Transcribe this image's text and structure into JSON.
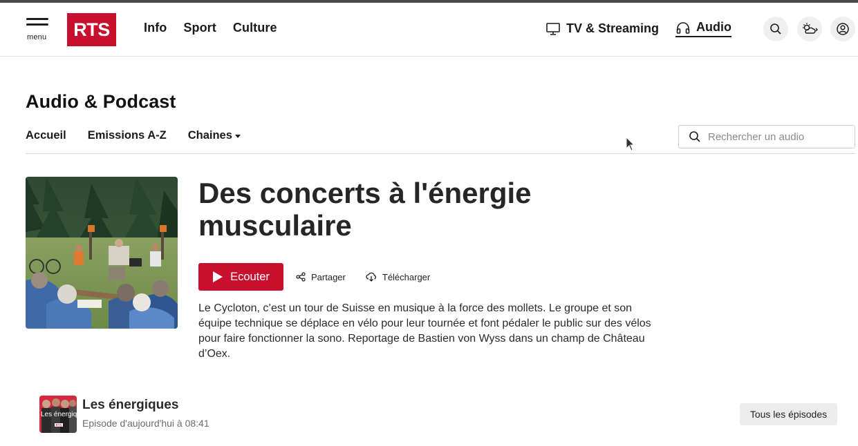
{
  "header": {
    "menu_label": "menu",
    "logo_text": "RTS",
    "nav": [
      "Info",
      "Sport",
      "Culture"
    ],
    "tv_label": "TV & Streaming",
    "audio_label": "Audio",
    "icons": [
      "menu-icon",
      "monitor-icon",
      "headphones-icon",
      "search-icon",
      "weather-icon",
      "user-icon"
    ]
  },
  "section": {
    "title": "Audio & Podcast",
    "subnav": [
      "Accueil",
      "Emissions A-Z",
      "Chaines"
    ],
    "search_placeholder": "Rechercher un audio"
  },
  "episode": {
    "title": "Des concerts à l'énergie musculaire",
    "play_label": "Ecouter",
    "share_label": "Partager",
    "download_label": "Télécharger",
    "description": "Le Cycloton, c’est un tour de Suisse en musique à la force des mollets. Le groupe et son équipe technique se déplace en vélo pour leur tournée et font pédaler le public sur des vélos pour faire fonctionner la sono. Reportage de Bastien von Wyss dans un champ de Château d’Oex."
  },
  "show": {
    "name": "Les énergiques",
    "thumb_text": "Les énergiques",
    "thumb_logo": "RTS",
    "date": "Episode d'aujourd'hui à 08:41",
    "all_episodes_label": "Tous les épisodes"
  },
  "colors": {
    "accent": "#c8102e",
    "text": "#1f1f1f"
  }
}
